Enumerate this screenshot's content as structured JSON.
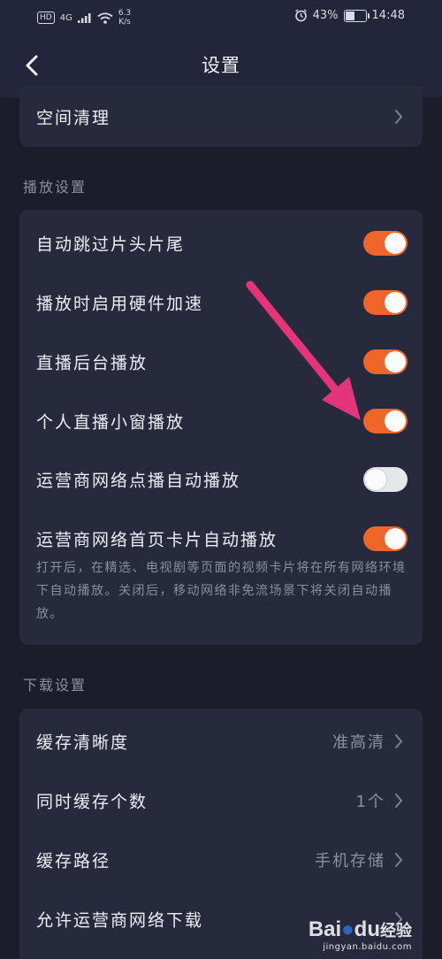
{
  "status_bar": {
    "network_badge": "HD",
    "network_type": "4G",
    "speed_value": "6.3",
    "speed_unit": "K/s",
    "battery": "43%",
    "time": "14:48"
  },
  "nav": {
    "title": "设置"
  },
  "clean_row": {
    "label": "空间清理"
  },
  "play_settings": {
    "header": "播放设置",
    "items": [
      {
        "label": "自动跳过片头片尾",
        "enabled": true
      },
      {
        "label": "播放时启用硬件加速",
        "enabled": true
      },
      {
        "label": "直播后台播放",
        "enabled": true
      },
      {
        "label": "个人直播小窗播放",
        "enabled": true
      },
      {
        "label": "运营商网络点播自动播放",
        "enabled": false
      },
      {
        "label": "运营商网络首页卡片自动播放",
        "enabled": true
      }
    ],
    "description": "打开后，在精选、电视剧等页面的视频卡片将在所有网络环境下自动播放。关闭后，移动网络非免流场景下将关闭自动播放。"
  },
  "download_settings": {
    "header": "下载设置",
    "items": [
      {
        "label": "缓存清晰度",
        "value": "准高清"
      },
      {
        "label": "同时缓存个数",
        "value": "1个"
      },
      {
        "label": "缓存路径",
        "value": "手机存储"
      },
      {
        "label": "允许运营商网络下载",
        "value": ""
      }
    ]
  },
  "watermark": {
    "logo_a": "Bai",
    "logo_b": "du",
    "logo_c": "经验",
    "url": "jingyan.baidu.com"
  },
  "colors": {
    "accent": "#f0652a",
    "background": "#1b1d2b",
    "card": "#272a3d",
    "annotation_arrow": "#e5357a"
  }
}
